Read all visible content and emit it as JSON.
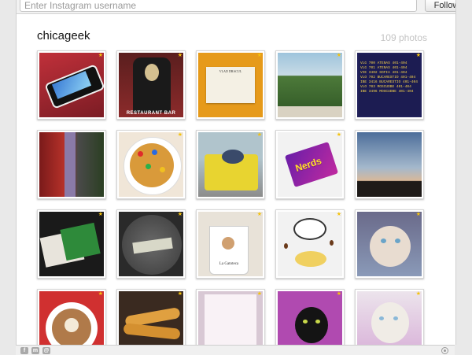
{
  "search": {
    "placeholder": "Enter Instagram username"
  },
  "toolbar": {
    "follow_label": "Follow"
  },
  "profile": {
    "username": "chicageek",
    "photo_count": "109 photos"
  },
  "colors": {
    "accent_star": "#f4c20d",
    "background": "#ffffff"
  },
  "photos": [
    {
      "name": "photo-iphone",
      "icon": "iphone-photo"
    },
    {
      "name": "photo-restaurant-bar",
      "icon": "shirt-photo",
      "caption": "RESTAURANT BAR"
    },
    {
      "name": "photo-vlad-dracul-plaque",
      "icon": "plaque-photo",
      "plaque_title": "VLAD DRACUL"
    },
    {
      "name": "photo-mountain-view",
      "icon": "landscape-photo"
    },
    {
      "name": "photo-departure-board",
      "icon": "departure-board-photo",
      "board_lines": [
        "VLG 700 ATENAS 401-404",
        "VLG 701 ATENAS 401-404",
        "VIE 3402 SOFIA 401-404",
        "VLO 702 BUCARESTIO 401-404",
        "IBE 3416 BUCARESTIO 401-404",
        "VLO 703 MOSCUDBE 401-404",
        "IBE 3496 MOSCUDBE 401-404"
      ]
    },
    {
      "name": "photo-street-lamp",
      "icon": "street-photo"
    },
    {
      "name": "photo-cookie",
      "icon": "cookie-photo"
    },
    {
      "name": "photo-pouf",
      "icon": "pouf-photo"
    },
    {
      "name": "photo-nerds-candy",
      "icon": "candy-photo",
      "candy_label": "Nerds"
    },
    {
      "name": "photo-sunset-sky",
      "icon": "sky-photo"
    },
    {
      "name": "photo-raspberry-pi",
      "icon": "circuit-board-photo"
    },
    {
      "name": "photo-speaker-closeup",
      "icon": "speaker-photo"
    },
    {
      "name": "photo-cat-mug",
      "icon": "mug-photo",
      "mug_label": "La Gatoteca"
    },
    {
      "name": "photo-coffee-croissant",
      "icon": "coffee-photo"
    },
    {
      "name": "photo-siamese-cat",
      "icon": "cat-photo"
    },
    {
      "name": "photo-latte-art",
      "icon": "latte-photo"
    },
    {
      "name": "photo-churros",
      "icon": "churros-photo"
    },
    {
      "name": "photo-menu",
      "icon": "menu-photo"
    },
    {
      "name": "photo-black-cat",
      "icon": "cat-photo"
    },
    {
      "name": "photo-white-cat",
      "icon": "cat-photo"
    }
  ],
  "footer": {
    "social_icons": [
      "facebook-icon",
      "myspace-icon",
      "email-icon"
    ],
    "brand_icon": "instagram-icon"
  }
}
